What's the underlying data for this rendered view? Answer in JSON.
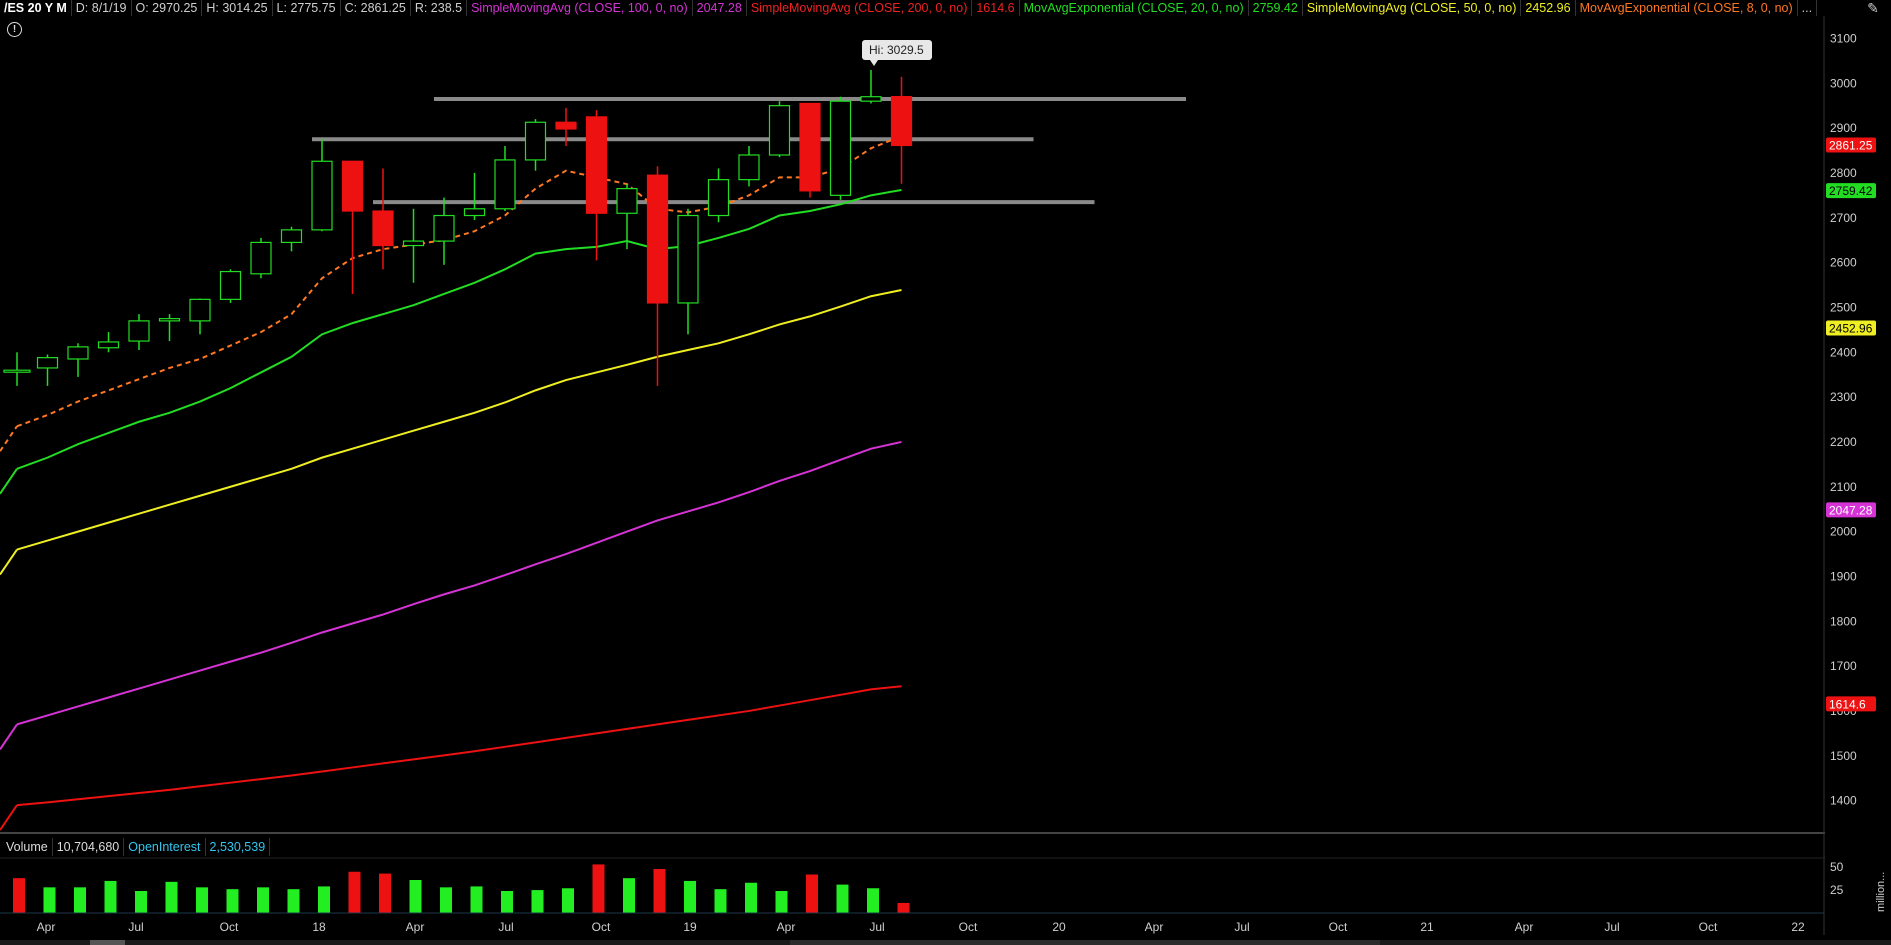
{
  "header": {
    "symbol": "/ES 20 Y M",
    "date": "D: 8/1/19",
    "open": "O: 2970.25",
    "high": "H: 3014.25",
    "low": "L: 2775.75",
    "close": "C: 2861.25",
    "range": "R: 238.5",
    "studies": [
      {
        "label": "SimpleMovingAvg (CLOSE, 100, 0, no)",
        "value": "2047.28",
        "color": "#d633d6"
      },
      {
        "label": "SimpleMovingAvg (CLOSE, 200, 0, no)",
        "value": "1614.6",
        "color": "#ee2222"
      },
      {
        "label": "MovAvgExponential (CLOSE, 20, 0, no)",
        "value": "2759.42",
        "color": "#22dd22"
      },
      {
        "label": "SimpleMovingAvg (CLOSE, 50, 0, no)",
        "value": "2452.96",
        "color": "#eeee22"
      },
      {
        "label": "MovAvgExponential (CLOSE, 8, 0, no)",
        "value": "...",
        "color": "#ff7722"
      }
    ],
    "info_icon": "!",
    "settings_icon": "pencil-icon"
  },
  "volume_legend": {
    "label": "Volume",
    "value": "10,704,680",
    "oi_label": "OpenInterest",
    "oi_value": "2,530,539"
  },
  "chart_data": {
    "type": "candlestick",
    "title": "/ES 20 Y M",
    "ylim": [
      1330,
      3150
    ],
    "yticks": [
      "3100",
      "3000",
      "2900",
      "2800",
      "2700",
      "2600",
      "2500",
      "2400",
      "2300",
      "2200",
      "2100",
      "2000",
      "1900",
      "1800",
      "1700",
      "1600",
      "1500",
      "1400"
    ],
    "xticks": [
      "Apr",
      "Jul",
      "Oct",
      "18",
      "Apr",
      "Jul",
      "Oct",
      "19",
      "Apr",
      "Jul",
      "Oct",
      "20",
      "Apr",
      "Jul",
      "Oct",
      "21",
      "Apr",
      "Jul",
      "Oct",
      "22"
    ],
    "hi_label": "Hi: 3029.5",
    "price_badges": [
      {
        "value": "2861.25",
        "bg": "#ee1111",
        "fg": "#ffffff"
      },
      {
        "value": "2759.42",
        "bg": "#22dd22",
        "fg": "#000000"
      },
      {
        "value": "2452.96",
        "bg": "#eeee22",
        "fg": "#000000"
      },
      {
        "value": "2047.28",
        "bg": "#d633d6",
        "fg": "#ffffff"
      },
      {
        "value": "1614.6",
        "bg": "#ee1111",
        "fg": "#ffffff"
      }
    ],
    "candles": [
      {
        "o": 2360,
        "h": 2400,
        "l": 2325,
        "c": 2360
      },
      {
        "o": 2365,
        "h": 2395,
        "l": 2325,
        "c": 2388
      },
      {
        "o": 2385,
        "h": 2420,
        "l": 2345,
        "c": 2412
      },
      {
        "o": 2410,
        "h": 2445,
        "l": 2400,
        "c": 2423
      },
      {
        "o": 2425,
        "h": 2485,
        "l": 2405,
        "c": 2470
      },
      {
        "o": 2470,
        "h": 2485,
        "l": 2425,
        "c": 2475
      },
      {
        "o": 2470,
        "h": 2520,
        "l": 2440,
        "c": 2518
      },
      {
        "o": 2518,
        "h": 2585,
        "l": 2510,
        "c": 2580
      },
      {
        "o": 2575,
        "h": 2655,
        "l": 2565,
        "c": 2645
      },
      {
        "o": 2645,
        "h": 2680,
        "l": 2625,
        "c": 2673
      },
      {
        "o": 2673,
        "h": 2875,
        "l": 2670,
        "c": 2826
      },
      {
        "o": 2826,
        "h": 2825,
        "l": 2530,
        "c": 2715
      },
      {
        "o": 2715,
        "h": 2810,
        "l": 2585,
        "c": 2638
      },
      {
        "o": 2638,
        "h": 2720,
        "l": 2555,
        "c": 2648
      },
      {
        "o": 2648,
        "h": 2745,
        "l": 2595,
        "c": 2705
      },
      {
        "o": 2705,
        "h": 2800,
        "l": 2695,
        "c": 2720
      },
      {
        "o": 2720,
        "h": 2860,
        "l": 2715,
        "c": 2829
      },
      {
        "o": 2829,
        "h": 2920,
        "l": 2805,
        "c": 2913
      },
      {
        "o": 2913,
        "h": 2945,
        "l": 2860,
        "c": 2898
      },
      {
        "o": 2925,
        "h": 2940,
        "l": 2605,
        "c": 2710
      },
      {
        "o": 2710,
        "h": 2775,
        "l": 2630,
        "c": 2765
      },
      {
        "o": 2795,
        "h": 2815,
        "l": 2325,
        "c": 2510
      },
      {
        "o": 2510,
        "h": 2720,
        "l": 2440,
        "c": 2705
      },
      {
        "o": 2705,
        "h": 2810,
        "l": 2690,
        "c": 2785
      },
      {
        "o": 2785,
        "h": 2860,
        "l": 2770,
        "c": 2840
      },
      {
        "o": 2840,
        "h": 2960,
        "l": 2835,
        "c": 2950
      },
      {
        "o": 2955,
        "h": 2955,
        "l": 2745,
        "c": 2760
      },
      {
        "o": 2750,
        "h": 2970,
        "l": 2740,
        "c": 2960
      },
      {
        "o": 2960,
        "h": 3029.5,
        "l": 2955,
        "c": 2970
      },
      {
        "o": 2970.25,
        "h": 3014.25,
        "l": 2775.75,
        "c": 2861.25
      }
    ],
    "ema8": [
      2235,
      2260,
      2290,
      2315,
      2340,
      2365,
      2385,
      2415,
      2445,
      2485,
      2565,
      2610,
      2630,
      2640,
      2650,
      2670,
      2705,
      2765,
      2805,
      2790,
      2775,
      2720,
      2712,
      2725,
      2750,
      2790,
      2790,
      2810,
      2855,
      2861
    ],
    "ema20": [
      2140,
      2165,
      2195,
      2220,
      2245,
      2265,
      2290,
      2320,
      2355,
      2390,
      2440,
      2465,
      2485,
      2505,
      2530,
      2555,
      2585,
      2620,
      2630,
      2635,
      2648,
      2630,
      2637,
      2655,
      2675,
      2705,
      2715,
      2730,
      2750,
      2759.42
    ],
    "sma50": [
      1960,
      1980,
      2000,
      2020,
      2040,
      2060,
      2080,
      2100,
      2120,
      2140,
      2165,
      2185,
      2205,
      2225,
      2245,
      2265,
      2288,
      2315,
      2338,
      2355,
      2372,
      2390,
      2405,
      2420,
      2440,
      2462,
      2480,
      2502,
      2525,
      2452.96
    ],
    "sma100": [
      1570,
      1590,
      1610,
      1630,
      1650,
      1670,
      1690,
      1710,
      1730,
      1752,
      1775,
      1795,
      1815,
      1838,
      1860,
      1880,
      1903,
      1927,
      1950,
      1975,
      2000,
      2025,
      2045,
      2065,
      2088,
      2113,
      2135,
      2160,
      2185,
      2047.28
    ],
    "sma200": [
      1390,
      1396,
      1403,
      1410,
      1417,
      1424,
      1432,
      1440,
      1448,
      1456,
      1465,
      1474,
      1483,
      1492,
      1501,
      1510,
      1520,
      1530,
      1540,
      1550,
      1560,
      1570,
      1580,
      1590,
      1600,
      1612,
      1624,
      1636,
      1648,
      1614.6
    ],
    "levels": [
      {
        "value": 2965,
        "from": 14,
        "to": 38
      },
      {
        "value": 2875,
        "from": 10,
        "to": 33
      },
      {
        "value": 2735,
        "from": 12,
        "to": 35
      }
    ],
    "volume": {
      "ylim": [
        0,
        60
      ],
      "yticks": [
        "50",
        "25"
      ],
      "values": [
        38,
        28,
        28,
        35,
        24,
        34,
        28,
        26,
        28,
        26,
        29,
        45,
        43,
        36,
        28,
        29,
        24,
        25,
        27,
        53,
        38,
        48,
        35,
        26,
        33,
        24,
        42,
        31,
        27,
        11
      ],
      "up": [
        false,
        true,
        true,
        true,
        true,
        true,
        true,
        true,
        true,
        true,
        true,
        false,
        false,
        true,
        true,
        true,
        true,
        true,
        true,
        false,
        true,
        false,
        true,
        true,
        true,
        true,
        false,
        true,
        true,
        false
      ],
      "unit_label": "million..."
    }
  }
}
